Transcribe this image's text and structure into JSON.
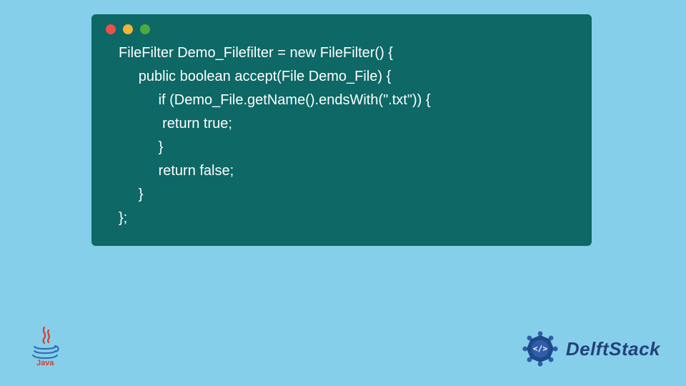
{
  "window": {
    "controls": {
      "red": "close",
      "yellow": "minimize",
      "green": "maximize"
    }
  },
  "code": {
    "line1": "FileFilter Demo_Filefilter = new FileFilter() {",
    "line2": "     public boolean accept(File Demo_File) {",
    "line3": "          if (Demo_File.getName().endsWith(\".txt\")) {",
    "line4": "           return true;",
    "line5": "          }",
    "line6": "          return false;",
    "line7": "     }",
    "line8": "};"
  },
  "branding": {
    "java_label": "Java",
    "delftstack_label": "DelftStack"
  },
  "colors": {
    "page_bg": "#86cfeb",
    "window_bg": "#0d6866",
    "code_text": "#ffffff",
    "dot_red": "#ec5049",
    "dot_yellow": "#f0b537",
    "dot_green": "#4aac3f",
    "java_red": "#d93a2b",
    "java_blue": "#2e6fb3",
    "ds_primary": "#22427a"
  }
}
